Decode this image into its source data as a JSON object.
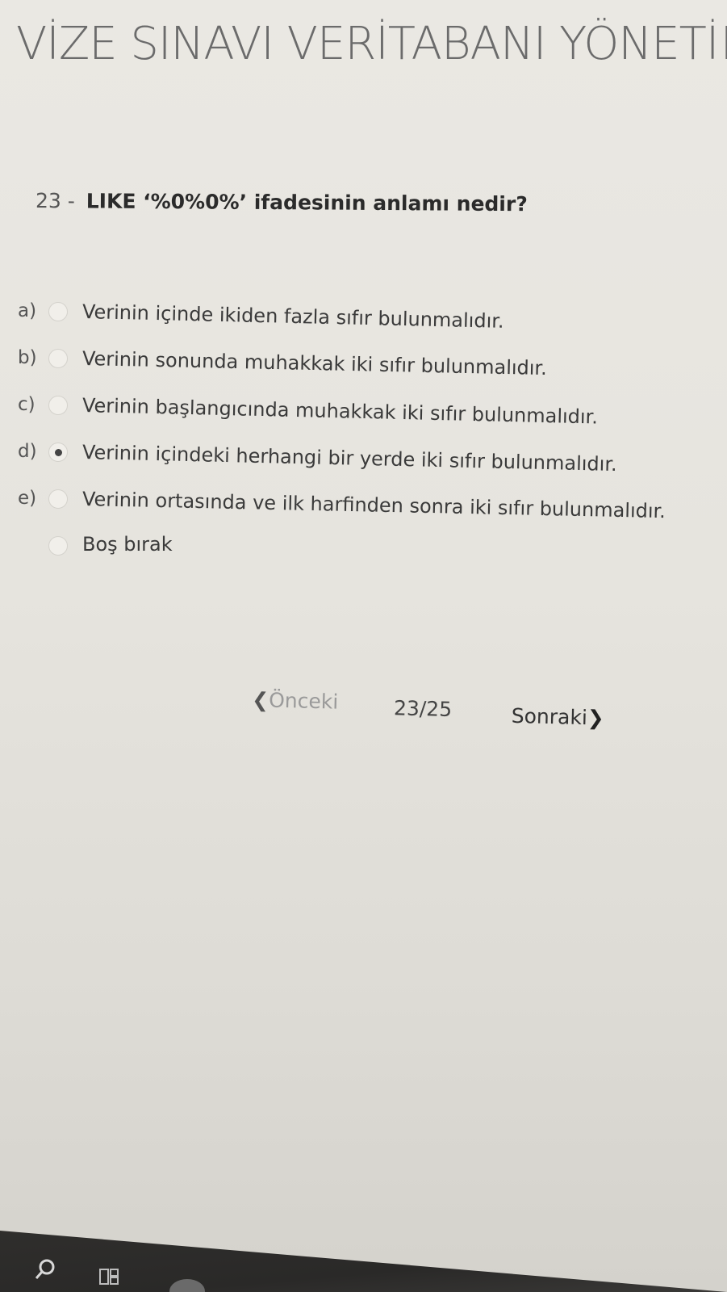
{
  "header": {
    "title": "VİZE SINAVI VERİTABANI YÖNETİM"
  },
  "question": {
    "number": "23 -",
    "text": "LIKE ‘%0%0%’ ifadesinin anlamı nedir?"
  },
  "options": [
    {
      "letter": "a)",
      "text": "Verinin içinde ikiden fazla sıfır bulunmalıdır.",
      "selected": false
    },
    {
      "letter": "b)",
      "text": "Verinin sonunda muhakkak iki sıfır bulunmalıdır.",
      "selected": false
    },
    {
      "letter": "c)",
      "text": "Verinin başlangıcında muhakkak iki sıfır bulunmalıdır.",
      "selected": false
    },
    {
      "letter": "d)",
      "text": "Verinin içindeki herhangi bir yerde iki sıfır bulunmalıdır.",
      "selected": true
    },
    {
      "letter": "e)",
      "text": "Verinin ortasında ve ilk harfinden sonra iki sıfır bulunmalıdır.",
      "selected": false
    },
    {
      "letter": "",
      "text": "Boş bırak",
      "selected": false
    }
  ],
  "pager": {
    "prev_chevron": "❮",
    "prev_label": "Önceki",
    "page": "23/25",
    "next_label": "Sonraki",
    "next_chevron": "❯"
  },
  "taskbar": {
    "icons": [
      "search-icon",
      "task-view-icon",
      "app-icon"
    ]
  },
  "colors": {
    "background": "#e9e7e2",
    "title_text": "#6b6b6b",
    "taskbar": "#2f2e2c"
  }
}
